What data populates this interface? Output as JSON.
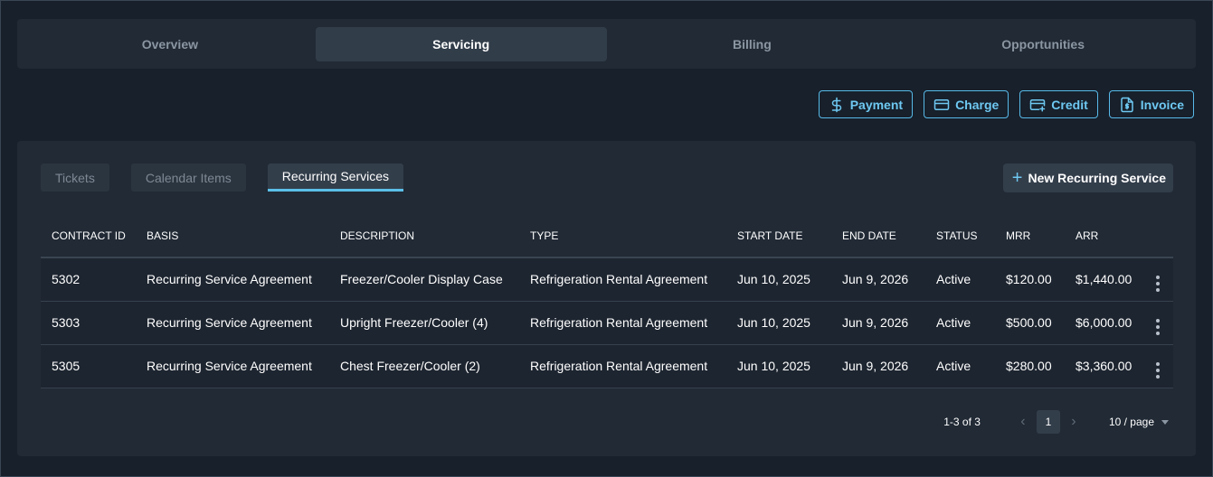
{
  "top_tabs": [
    {
      "label": "Overview"
    },
    {
      "label": "Servicing"
    },
    {
      "label": "Billing"
    },
    {
      "label": "Opportunities"
    }
  ],
  "actions": {
    "payment": "Payment",
    "charge": "Charge",
    "credit": "Credit",
    "invoice": "Invoice"
  },
  "sub_tabs": [
    {
      "label": "Tickets"
    },
    {
      "label": "Calendar Items"
    },
    {
      "label": "Recurring Services"
    }
  ],
  "new_button": "New Recurring Service",
  "table": {
    "columns": [
      "CONTRACT ID",
      "BASIS",
      "DESCRIPTION",
      "TYPE",
      "START DATE",
      "END DATE",
      "STATUS",
      "MRR",
      "ARR"
    ],
    "rows": [
      [
        "5302",
        "Recurring Service Agreement",
        "Freezer/Cooler Display Case",
        "Refrigeration Rental Agreement",
        "Jun 10, 2025",
        "Jun 9, 2026",
        "Active",
        "$120.00",
        "$1,440.00"
      ],
      [
        "5303",
        "Recurring Service Agreement",
        "Upright Freezer/Cooler (4)",
        "Refrigeration Rental Agreement",
        "Jun 10, 2025",
        "Jun 9, 2026",
        "Active",
        "$500.00",
        "$6,000.00"
      ],
      [
        "5305",
        "Recurring Service Agreement",
        "Chest Freezer/Cooler (2)",
        "Refrigeration Rental Agreement",
        "Jun 10, 2025",
        "Jun 9, 2026",
        "Active",
        "$280.00",
        "$3,360.00"
      ]
    ]
  },
  "pagination": {
    "count": "1-3 of 3",
    "page": "1",
    "page_size": "10 / page"
  },
  "colors": {
    "accent": "#5bbfe8",
    "background": "#17202b",
    "panel": "#212a35"
  }
}
